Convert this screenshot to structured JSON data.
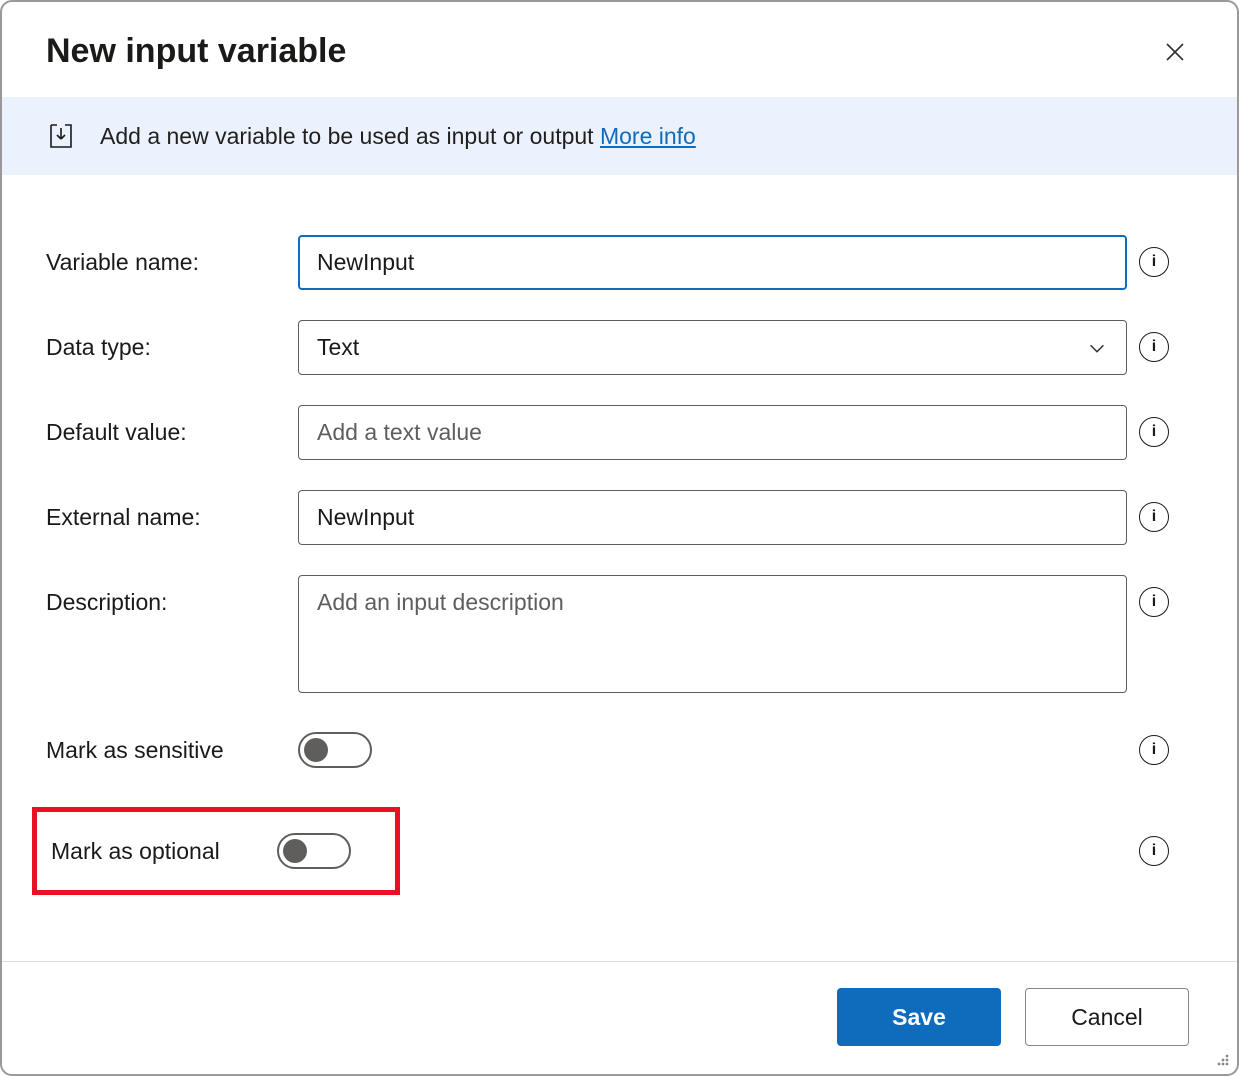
{
  "dialog": {
    "title": "New input variable",
    "info_text": "Add a new variable to be used as input or output ",
    "more_info_label": "More info"
  },
  "fields": {
    "variable_name": {
      "label": "Variable name:",
      "value": "NewInput"
    },
    "data_type": {
      "label": "Data type:",
      "value": "Text"
    },
    "default_value": {
      "label": "Default value:",
      "value": "",
      "placeholder": "Add a text value"
    },
    "external_name": {
      "label": "External name:",
      "value": "NewInput"
    },
    "description": {
      "label": "Description:",
      "value": "",
      "placeholder": "Add an input description"
    },
    "mark_sensitive": {
      "label": "Mark as sensitive",
      "on": false
    },
    "mark_optional": {
      "label": "Mark as optional",
      "on": false
    }
  },
  "footer": {
    "save_label": "Save",
    "cancel_label": "Cancel"
  }
}
